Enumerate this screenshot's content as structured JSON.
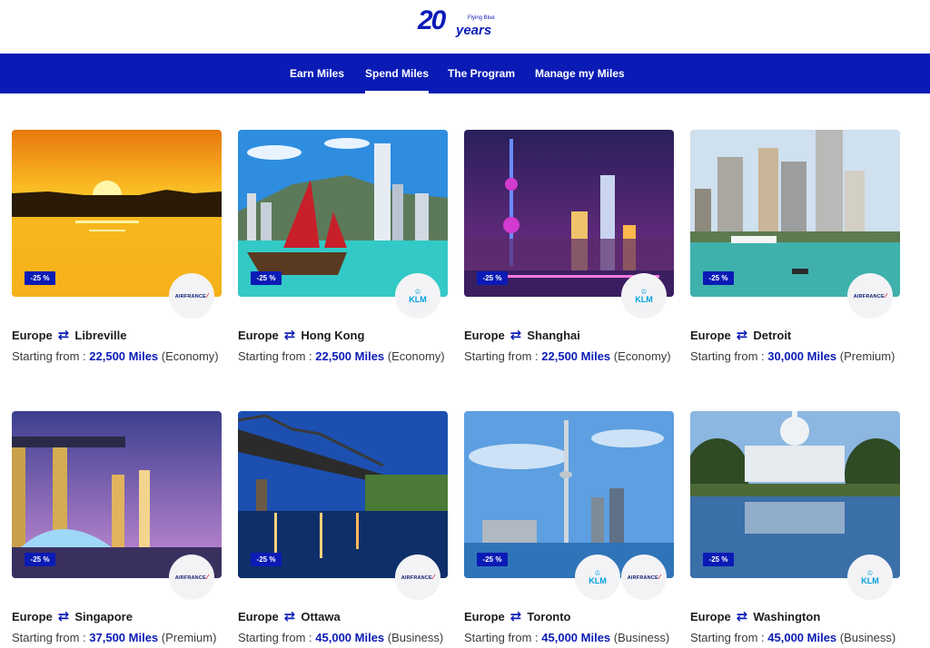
{
  "logo": {
    "number": "20",
    "word": "years",
    "brand": "Flying Blue"
  },
  "nav": [
    {
      "label": "Earn Miles",
      "active": false
    },
    {
      "label": "Spend Miles",
      "active": true
    },
    {
      "label": "The Program",
      "active": false
    },
    {
      "label": "Manage my Miles",
      "active": false
    }
  ],
  "colors": {
    "brand_blue": "#0a1bb5",
    "text": "#1c1c1c",
    "airfrance_red": "#d8001a",
    "klm_blue": "#00a1de"
  },
  "offers": [
    {
      "origin": "Europe",
      "destination": "Libreville",
      "from_label": "Starting from :",
      "miles": "22,500 Miles",
      "cabin": "(Economy)",
      "discount": "-25 %",
      "airlines": [
        "AIRFRANCE"
      ]
    },
    {
      "origin": "Europe",
      "destination": "Hong Kong",
      "from_label": "Starting from :",
      "miles": "22,500 Miles",
      "cabin": "(Economy)",
      "discount": "-25 %",
      "airlines": [
        "KLM"
      ]
    },
    {
      "origin": "Europe",
      "destination": "Shanghai",
      "from_label": "Starting from :",
      "miles": "22,500 Miles",
      "cabin": "(Economy)",
      "discount": "-25 %",
      "airlines": [
        "KLM"
      ]
    },
    {
      "origin": "Europe",
      "destination": "Detroit",
      "from_label": "Starting from :",
      "miles": "30,000 Miles",
      "cabin": "(Premium)",
      "discount": "-25 %",
      "airlines": [
        "AIRFRANCE"
      ]
    },
    {
      "origin": "Europe",
      "destination": "Singapore",
      "from_label": "Starting from :",
      "miles": "37,500 Miles",
      "cabin": "(Premium)",
      "discount": "-25 %",
      "airlines": [
        "AIRFRANCE"
      ]
    },
    {
      "origin": "Europe",
      "destination": "Ottawa",
      "from_label": "Starting from :",
      "miles": "45,000 Miles",
      "cabin": "(Business)",
      "discount": "-25 %",
      "airlines": [
        "AIRFRANCE"
      ]
    },
    {
      "origin": "Europe",
      "destination": "Toronto",
      "from_label": "Starting from :",
      "miles": "45,000 Miles",
      "cabin": "(Business)",
      "discount": "-25 %",
      "airlines": [
        "KLM",
        "AIRFRANCE"
      ]
    },
    {
      "origin": "Europe",
      "destination": "Washington",
      "from_label": "Starting from :",
      "miles": "45,000 Miles",
      "cabin": "(Business)",
      "discount": "-25 %",
      "airlines": [
        "KLM"
      ]
    }
  ]
}
